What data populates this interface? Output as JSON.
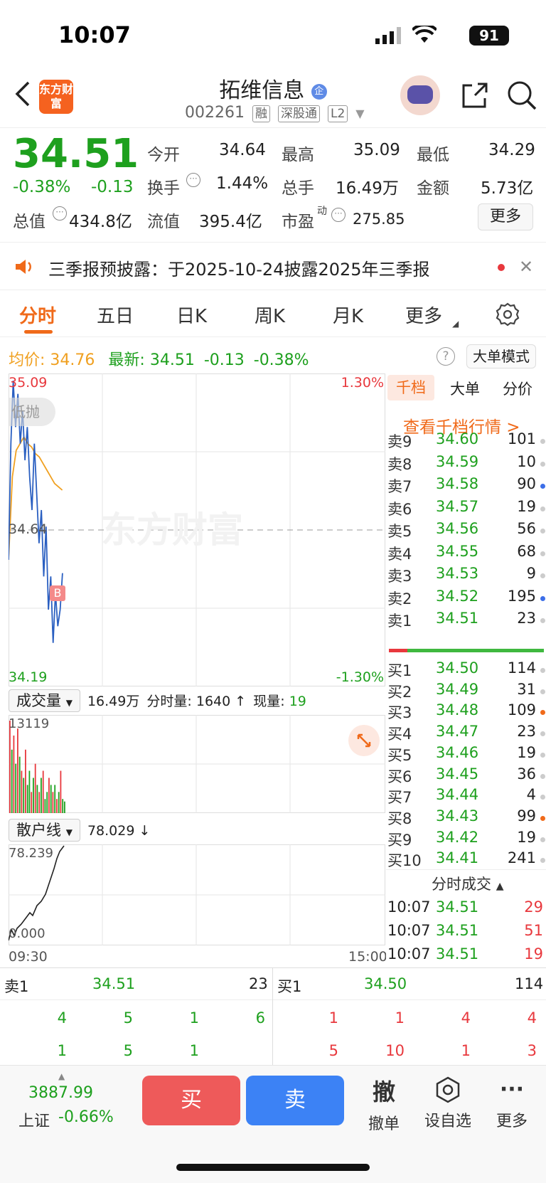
{
  "status": {
    "time": "10:07",
    "battery": "91"
  },
  "header": {
    "app_logo": "东方财富",
    "stock_name": "拓维信息",
    "name_badge": "企",
    "code": "002261",
    "tags": [
      "融",
      "深股通",
      "L2"
    ]
  },
  "quote": {
    "price": "34.51",
    "change_pct": "-0.38%",
    "change": "-0.13",
    "fields": [
      {
        "label": "今开",
        "value": "34.64",
        "color": "#222"
      },
      {
        "label": "最高",
        "value": "35.09",
        "color": "#e8383d"
      },
      {
        "label": "最低",
        "value": "34.29",
        "color": "#1ea01e"
      },
      {
        "label": "换手",
        "value": "1.44%",
        "color": "#222"
      },
      {
        "label": "总手",
        "value": "16.49万",
        "color": "#222"
      },
      {
        "label": "金额",
        "value": "5.73亿",
        "color": "#222"
      },
      {
        "label": "总值",
        "value": "434.8亿",
        "color": "#222"
      },
      {
        "label": "流值",
        "value": "395.4亿",
        "color": "#222"
      },
      {
        "label": "市盈",
        "sup": "动",
        "value": "275.85",
        "color": "#222"
      }
    ],
    "more_label": "更多"
  },
  "notice": {
    "text": "三季报预披露：于2025-10-24披露2025年三季报"
  },
  "tabs": [
    "分时",
    "五日",
    "日K",
    "周K",
    "月K",
    "更多"
  ],
  "avg_line": {
    "avg_label": "均价:",
    "avg_value": "34.76",
    "latest_label": "最新:",
    "latest_value": "34.51",
    "change": "-0.13",
    "change_pct": "-0.38%",
    "mode_label": "大单模式"
  },
  "chart": {
    "high": "35.09",
    "high_pct": "1.30%",
    "mid": "34.64",
    "low": "34.19",
    "low_pct": "-1.30%",
    "bubble": "低抛",
    "marker": "B",
    "watermark": "东方财富"
  },
  "volume": {
    "dropdown": "成交量",
    "total": "16.49万",
    "minute_label": "分时量: 1640",
    "now_label": "现量:",
    "now_value": "19",
    "max_label": "13119"
  },
  "retail": {
    "dropdown": "散户线",
    "value": "78.029",
    "max_label": "78.239",
    "min_label": "0.000",
    "start_time": "09:30",
    "end_time": "15:00"
  },
  "book": {
    "tabs": [
      "千档",
      "大单",
      "分价"
    ],
    "link": "查看千档行情 >",
    "asks": [
      {
        "label": "卖9",
        "price": "34.60",
        "vol": "101",
        "dot": "#ccc"
      },
      {
        "label": "卖8",
        "price": "34.59",
        "vol": "10",
        "dot": "#ccc"
      },
      {
        "label": "卖7",
        "price": "34.58",
        "vol": "90",
        "dot": "#3c6ee8"
      },
      {
        "label": "卖6",
        "price": "34.57",
        "vol": "19",
        "dot": "#ccc"
      },
      {
        "label": "卖5",
        "price": "34.56",
        "vol": "56",
        "dot": "#ccc"
      },
      {
        "label": "卖4",
        "price": "34.55",
        "vol": "68",
        "dot": "#ccc"
      },
      {
        "label": "卖3",
        "price": "34.53",
        "vol": "9",
        "dot": "#ccc"
      },
      {
        "label": "卖2",
        "price": "34.52",
        "vol": "195",
        "dot": "#3c6ee8"
      },
      {
        "label": "卖1",
        "price": "34.51",
        "vol": "23",
        "dot": "#ccc"
      }
    ],
    "bids": [
      {
        "label": "买1",
        "price": "34.50",
        "vol": "114",
        "dot": "#ccc"
      },
      {
        "label": "买2",
        "price": "34.49",
        "vol": "31",
        "dot": "#ccc"
      },
      {
        "label": "买3",
        "price": "34.48",
        "vol": "109",
        "dot": "#f06a1a"
      },
      {
        "label": "买4",
        "price": "34.47",
        "vol": "23",
        "dot": "#ccc"
      },
      {
        "label": "买5",
        "price": "34.46",
        "vol": "19",
        "dot": "#ccc"
      },
      {
        "label": "买6",
        "price": "34.45",
        "vol": "36",
        "dot": "#ccc"
      },
      {
        "label": "买7",
        "price": "34.44",
        "vol": "4",
        "dot": "#ccc"
      },
      {
        "label": "买8",
        "price": "34.43",
        "vol": "99",
        "dot": "#f06a1a"
      },
      {
        "label": "买9",
        "price": "34.42",
        "vol": "19",
        "dot": "#ccc"
      },
      {
        "label": "买10",
        "price": "34.41",
        "vol": "241",
        "dot": "#ccc"
      }
    ],
    "trades_title": "分时成交",
    "trades": [
      {
        "time": "10:07",
        "price": "34.51",
        "vol": "29"
      },
      {
        "time": "10:07",
        "price": "34.51",
        "vol": "51"
      },
      {
        "time": "10:07",
        "price": "34.51",
        "vol": "19"
      }
    ]
  },
  "level1": {
    "sell_label": "卖1",
    "sell_price": "34.51",
    "sell_vol": "23",
    "buy_label": "买1",
    "buy_price": "34.50",
    "buy_vol": "114",
    "sell_queue": [
      [
        "4",
        "5",
        "1",
        "6"
      ],
      [
        "1",
        "5",
        "1",
        ""
      ]
    ],
    "buy_queue": [
      [
        "1",
        "1",
        "4",
        "4"
      ],
      [
        "5",
        "10",
        "1",
        "3"
      ]
    ]
  },
  "bottom": {
    "index_value": "3887.99",
    "index_name": "上证",
    "index_change": "-0.66%",
    "buy": "买",
    "sell": "卖",
    "cancel_glyph": "撤",
    "cancel_label": "撤单",
    "watch_label": "设自选",
    "more_label": "更多"
  },
  "chart_data": {
    "type": "line",
    "y_range": [
      34.19,
      35.09
    ],
    "price_series_note": "",
    "price": [
      34.55,
      34.9,
      35.09,
      34.95,
      35.05,
      34.9,
      35.0,
      34.85,
      34.95,
      34.8,
      34.7,
      34.9,
      34.75,
      34.6,
      34.7,
      34.5,
      34.65,
      34.4,
      34.5,
      34.3,
      34.45,
      34.35,
      34.4,
      34.51
    ],
    "avg": [
      34.55,
      34.8,
      34.88,
      34.9,
      34.92,
      34.9,
      34.89,
      34.87,
      34.86,
      34.84,
      34.82,
      34.8,
      34.78,
      34.77,
      34.76
    ],
    "volume": [
      13119,
      9000,
      11000,
      7000,
      12000,
      8000,
      6000,
      5000,
      9000,
      4000,
      6000,
      3000,
      5000,
      7000,
      4000,
      3000,
      5000,
      6000,
      2000,
      3000,
      5000,
      4000,
      3000,
      4000,
      2000,
      3000,
      6000,
      2000,
      1640
    ],
    "volume_colors": [
      "r",
      "g",
      "r",
      "g",
      "r",
      "g",
      "r",
      "g",
      "r",
      "g",
      "g",
      "r",
      "g",
      "r",
      "g",
      "r",
      "g",
      "r",
      "g",
      "g",
      "r",
      "g",
      "r",
      "g",
      "r",
      "g",
      "r",
      "g",
      "g"
    ]
  }
}
